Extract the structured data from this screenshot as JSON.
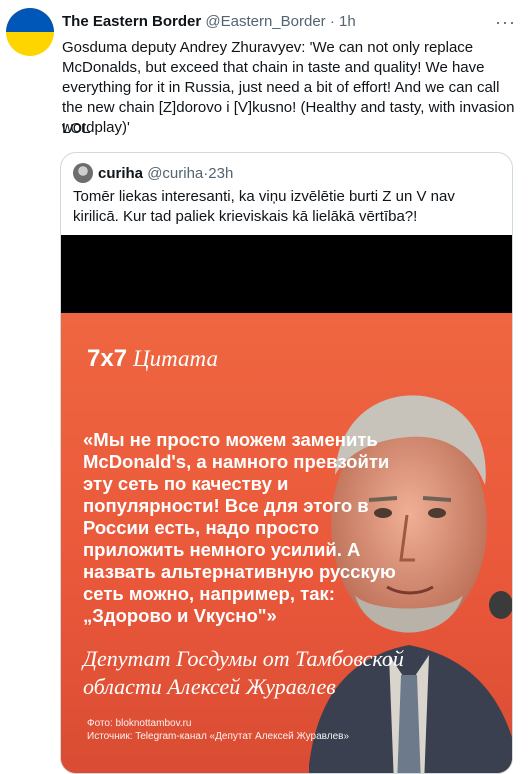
{
  "tweet": {
    "author_name": "The Eastern Border",
    "author_handle": "@Eastern_Border",
    "separator": " · ",
    "time": "1h",
    "more_icon": "···",
    "text": "Gosduma deputy Andrey Zhuravyev: 'We can not only replace McDonalds, but exceed that chain in taste and quality! We have everything for it in Russia, just need a bit of effort! And we can call the new chain [Z]dorovo i [V]kusno! (Healthy and tasty, with invasion wordplay)'",
    "text2": "LOL",
    "avatar_flag_colors": [
      "#0057b7",
      "#ffd500"
    ]
  },
  "quoted_tweet": {
    "author_name": "curiha",
    "author_handle": "@curiha",
    "separator": " · ",
    "time": "23h",
    "text": "Tomēr liekas interesanti, ka viņu izvēlētie burti Z un V nav kirilicā. Kur tad paliek krieviskais kā lielākā vērtība?!"
  },
  "media": {
    "logo": "7x7",
    "logo_script": "Цитата",
    "quote": "«Мы не просто можем заменить McDonald's, а намного превзойти эту сеть по качеству и популярности! Все для этого в России есть, надо просто приложить немного усилий. А назвать альтернативную русскую сеть можно, например, так: „Здорово и Vкусно\"»",
    "attribution": "Депутат Госдумы от Тамбовской области Алексей Журавлев",
    "photo_credit": "Фото: bloknottambov.ru",
    "source_credit": "Источник: Telegram-канал «Депутат Алексей Журавлев»",
    "background_color": "#ec5f3a"
  }
}
